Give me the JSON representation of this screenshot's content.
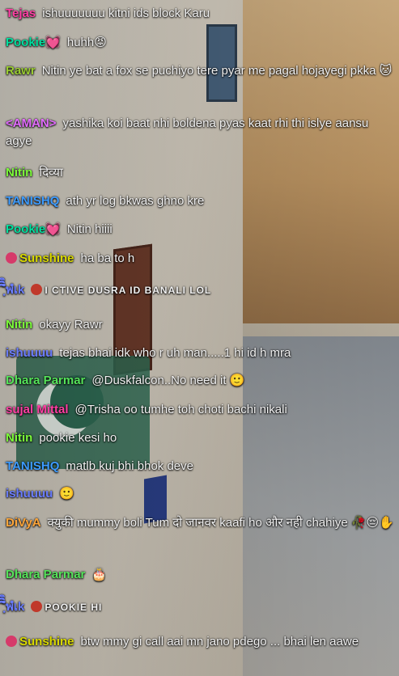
{
  "messages": [
    {
      "user": "Tejas",
      "color": "#ff3fa4",
      "text": "ishuuuuuuu kitni ids block Karu"
    },
    {
      "user": "Pookie💓",
      "color": "#00e0a0",
      "text": "huhh😡"
    },
    {
      "user": "Rawr",
      "color": "#9acd32",
      "text": "Nitin ye bat a fox se puchiyo tere pyar me pagal hojayegi pkka 🐱"
    },
    {
      "user": "<AMAN>",
      "color": "#e36dff",
      "text": "yashika koi baat nhi boldena pyas kaat rhi thi islye aansu agye"
    },
    {
      "user": "Nitin",
      "color": "#7cfc3a",
      "text": "दिव्या"
    },
    {
      "user": "TANISHQ",
      "color": "#3d9bff",
      "text": "ath yr log bkwas ghno kre"
    },
    {
      "user": "Pookie💓",
      "color": "#00e0a0",
      "text": "Nitin hiiii"
    },
    {
      "user": "Sunshine",
      "color": "#dada00",
      "text": "ha ba to h"
    },
    {
      "user": "ิิิฺํพํเk",
      "color": "#6a7dff",
      "text": "I CTIVE DUSRA ID BANALI LOL"
    },
    {
      "user": "Nitin",
      "color": "#7cfc3a",
      "text": "okayy Rawr"
    },
    {
      "user": "ishuuuu",
      "color": "#6a7dff",
      "text": "tejas bhai idk who r uh man.....1 hi id h mra"
    },
    {
      "user": "Dhara Parmar",
      "color": "#55e35a",
      "text": "@Duskfalcon..No need it 🙂"
    },
    {
      "user": "sujal Mittal",
      "color": "#ff3fa4",
      "text": "@Trisha oo tumhe toh choti bachi nikali"
    },
    {
      "user": "Nitin",
      "color": "#7cfc3a",
      "text": "pookie kesi ho"
    },
    {
      "user": "TANISHQ",
      "color": "#3d9bff",
      "text": "matlb kuj bhi bhok deve"
    },
    {
      "user": "ishuuuu",
      "color": "#6a7dff",
      "text": "🙂"
    },
    {
      "user": "DiVyA",
      "color": "#ffa63a",
      "text": "क्युकी mummy boli Tum दो जानवर kaafi ho और नही chahiye 🥀😔✋"
    },
    {
      "user": "Dhara Parmar",
      "color": "#55e35a",
      "text": "🎂"
    },
    {
      "user": "ิิิฺํพํเk",
      "color": "#6a7dff",
      "text": "POOKIE HI"
    },
    {
      "user": "Sunshine",
      "color": "#dada00",
      "text": "btw mmy gi call aai mn jano pdego ... bhai len aawe"
    }
  ]
}
